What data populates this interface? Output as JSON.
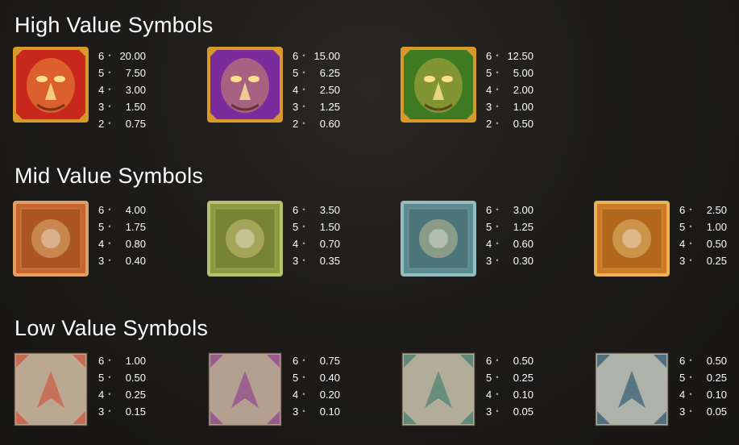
{
  "sections": [
    {
      "title": "High Value Symbols",
      "symbols": [
        {
          "icon": "red-lion-mask-icon",
          "bg": "#c8281c",
          "frame": "#d79a2a",
          "pays": [
            {
              "count": "6",
              "value": "20.00"
            },
            {
              "count": "5",
              "value": "7.50"
            },
            {
              "count": "4",
              "value": "3.00"
            },
            {
              "count": "3",
              "value": "1.50"
            },
            {
              "count": "2",
              "value": "0.75"
            }
          ]
        },
        {
          "icon": "purple-eagle-mask-icon",
          "bg": "#7a2c9c",
          "frame": "#d79a2a",
          "pays": [
            {
              "count": "6",
              "value": "15.00"
            },
            {
              "count": "5",
              "value": "6.25"
            },
            {
              "count": "4",
              "value": "2.50"
            },
            {
              "count": "3",
              "value": "1.25"
            },
            {
              "count": "2",
              "value": "0.60"
            }
          ]
        },
        {
          "icon": "green-owl-mask-icon",
          "bg": "#3e7a22",
          "frame": "#d79a2a",
          "pays": [
            {
              "count": "6",
              "value": "12.50"
            },
            {
              "count": "5",
              "value": "5.00"
            },
            {
              "count": "4",
              "value": "2.00"
            },
            {
              "count": "3",
              "value": "1.00"
            },
            {
              "count": "2",
              "value": "0.50"
            }
          ]
        }
      ]
    },
    {
      "title": "Mid Value Symbols",
      "symbols": [
        {
          "icon": "claw-icon",
          "bg": "#c9642a",
          "frame": "#e0a065",
          "pays": [
            {
              "count": "6",
              "value": "4.00"
            },
            {
              "count": "5",
              "value": "1.75"
            },
            {
              "count": "4",
              "value": "0.80"
            },
            {
              "count": "3",
              "value": "0.40"
            }
          ]
        },
        {
          "icon": "green-vase-icon",
          "bg": "#8a9a3c",
          "frame": "#b7c270",
          "pays": [
            {
              "count": "6",
              "value": "3.50"
            },
            {
              "count": "5",
              "value": "1.50"
            },
            {
              "count": "4",
              "value": "0.70"
            },
            {
              "count": "3",
              "value": "0.35"
            }
          ]
        },
        {
          "icon": "axe-icon",
          "bg": "#5a8a92",
          "frame": "#96bcc0",
          "pays": [
            {
              "count": "6",
              "value": "3.00"
            },
            {
              "count": "5",
              "value": "1.25"
            },
            {
              "count": "4",
              "value": "0.60"
            },
            {
              "count": "3",
              "value": "0.30"
            }
          ]
        },
        {
          "icon": "golden-wheel-icon",
          "bg": "#d07a22",
          "frame": "#eab25a",
          "pays": [
            {
              "count": "6",
              "value": "2.50"
            },
            {
              "count": "5",
              "value": "1.00"
            },
            {
              "count": "4",
              "value": "0.50"
            },
            {
              "count": "3",
              "value": "0.25"
            }
          ]
        }
      ]
    },
    {
      "title": "Low Value Symbols",
      "symbols": [
        {
          "icon": "red-a-rune-icon",
          "bg": "#bba892",
          "frame": "#c96a55",
          "pays": [
            {
              "count": "6",
              "value": "1.00"
            },
            {
              "count": "5",
              "value": "0.50"
            },
            {
              "count": "4",
              "value": "0.25"
            },
            {
              "count": "3",
              "value": "0.15"
            }
          ]
        },
        {
          "icon": "purple-k-rune-icon",
          "bg": "#b4a090",
          "frame": "#9a5a8e",
          "pays": [
            {
              "count": "6",
              "value": "0.75"
            },
            {
              "count": "5",
              "value": "0.40"
            },
            {
              "count": "4",
              "value": "0.20"
            },
            {
              "count": "3",
              "value": "0.10"
            }
          ]
        },
        {
          "icon": "green-diamond-rune-icon",
          "bg": "#b2ad98",
          "frame": "#5f8a7a",
          "pays": [
            {
              "count": "6",
              "value": "0.50"
            },
            {
              "count": "5",
              "value": "0.25"
            },
            {
              "count": "4",
              "value": "0.10"
            },
            {
              "count": "3",
              "value": "0.05"
            }
          ]
        },
        {
          "icon": "blue-chevron-rune-icon",
          "bg": "#adb3a8",
          "frame": "#4f6e80",
          "pays": [
            {
              "count": "6",
              "value": "0.50"
            },
            {
              "count": "5",
              "value": "0.25"
            },
            {
              "count": "4",
              "value": "0.10"
            },
            {
              "count": "3",
              "value": "0.05"
            }
          ]
        }
      ]
    }
  ]
}
